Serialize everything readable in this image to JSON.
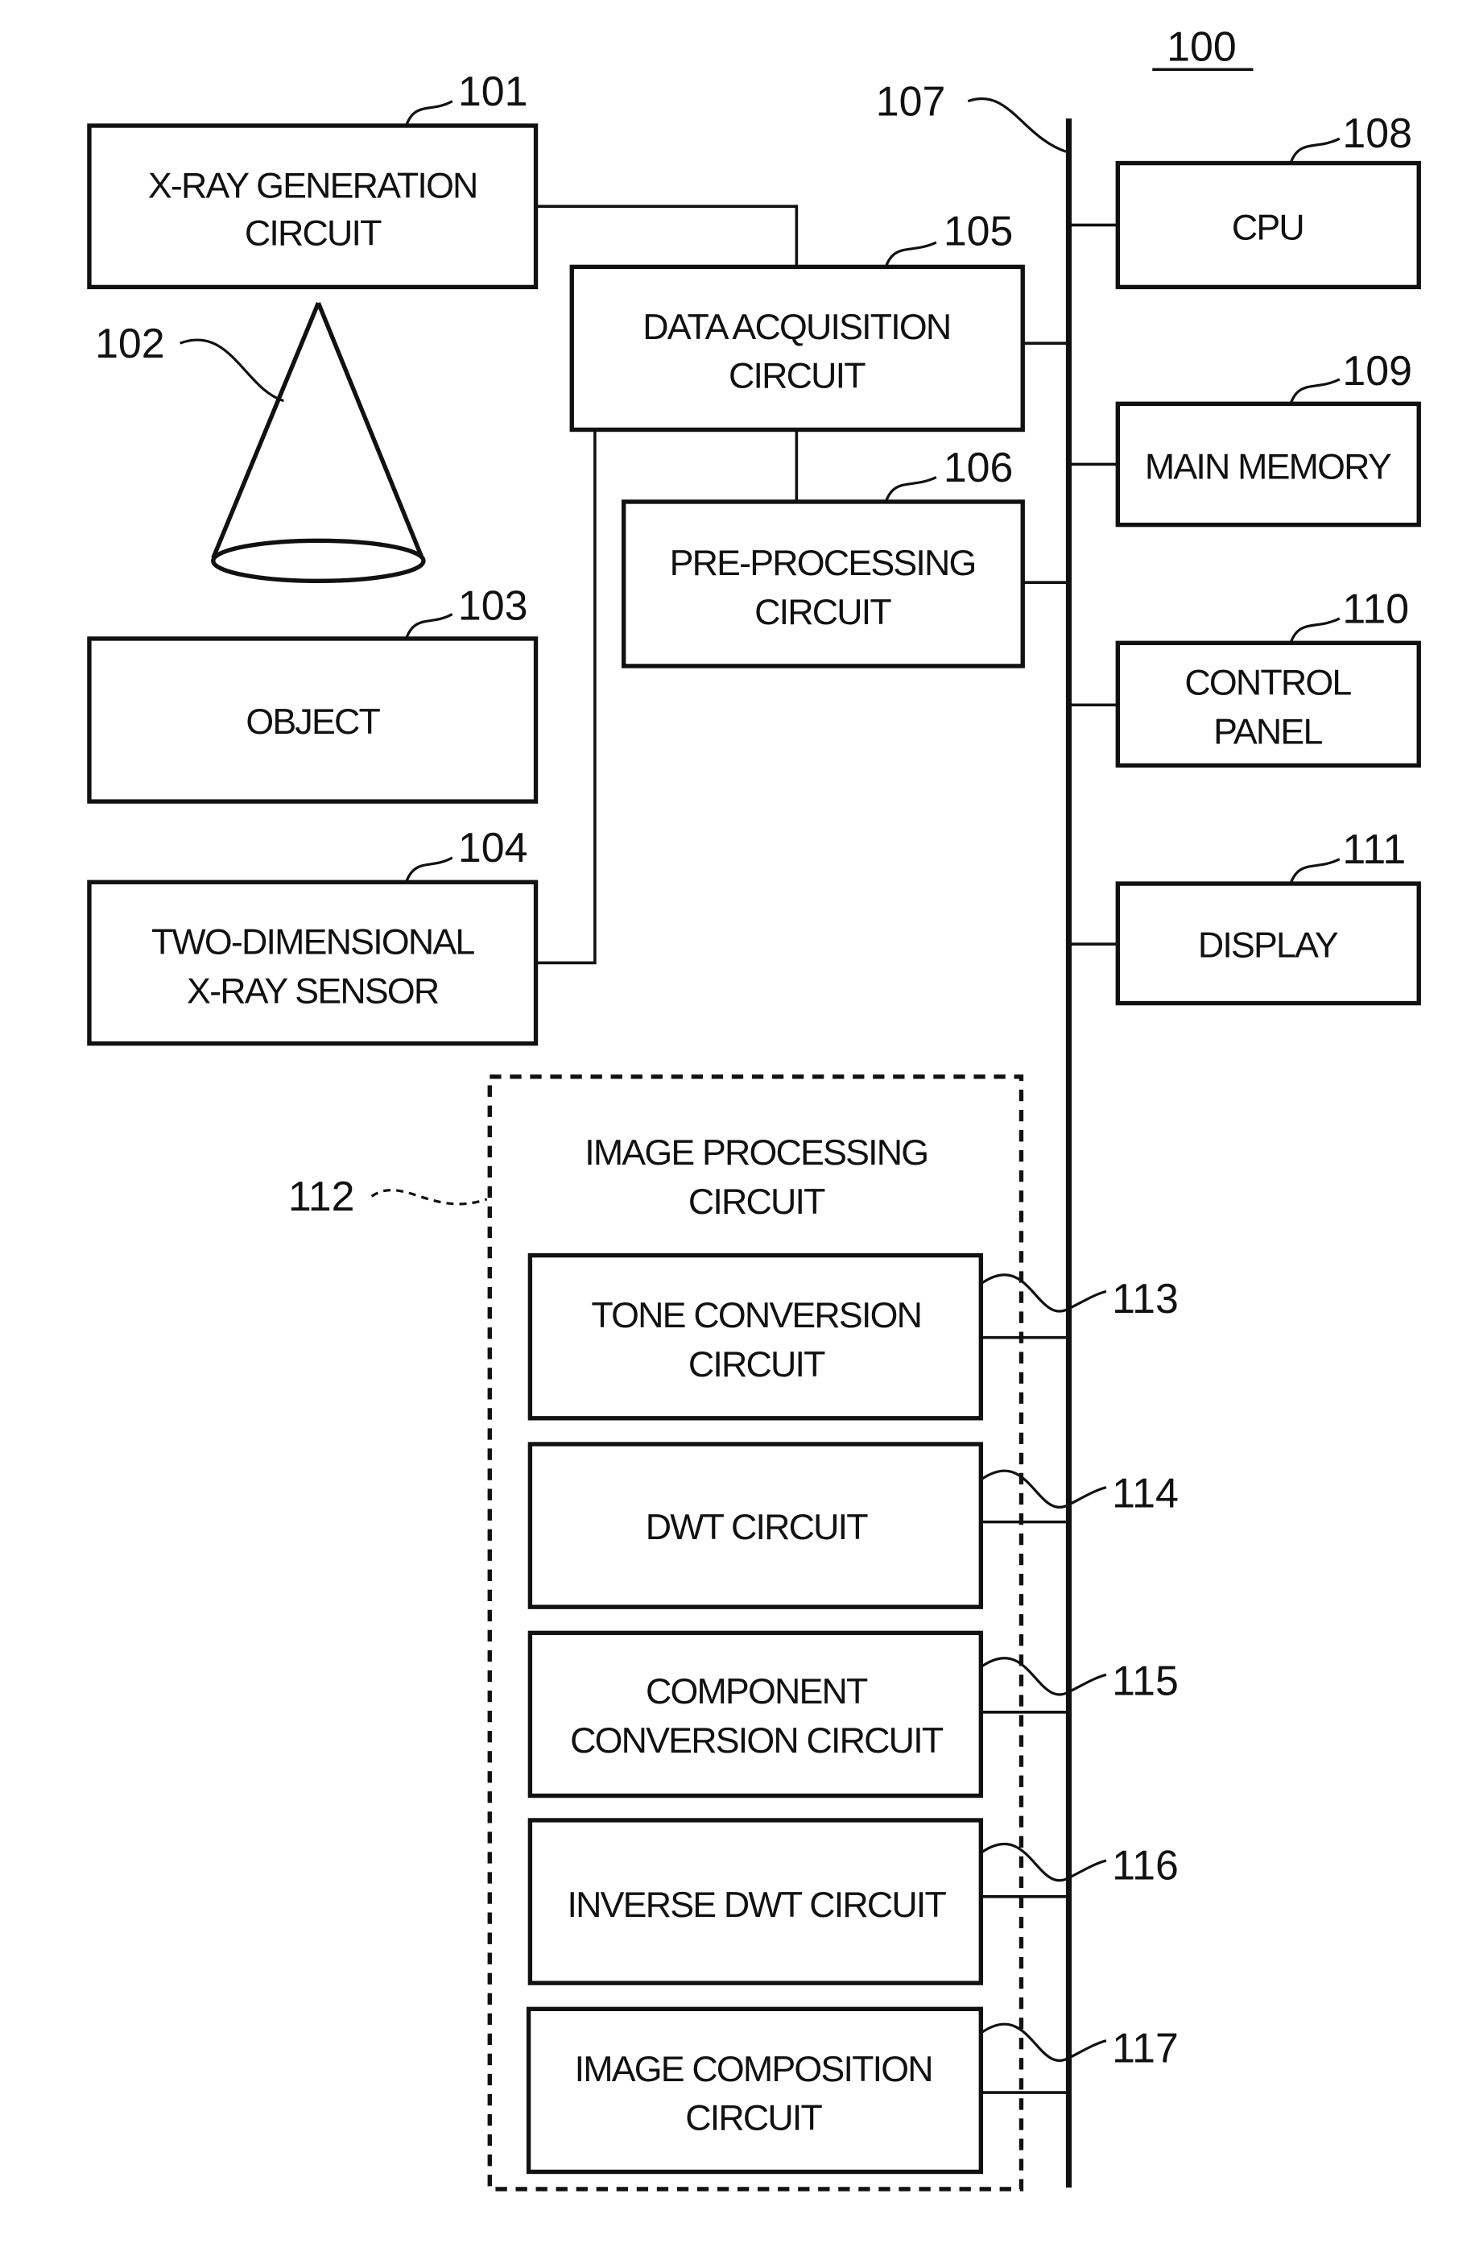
{
  "figure_ref": "100",
  "bus_ref": "107",
  "blocks": {
    "b101": {
      "ref": "101",
      "lines": [
        "X-RAY GENERATION",
        "CIRCUIT"
      ]
    },
    "b102": {
      "ref": "102",
      "lines": []
    },
    "b103": {
      "ref": "103",
      "lines": [
        "OBJECT"
      ]
    },
    "b104": {
      "ref": "104",
      "lines": [
        "TWO-DIMENSIONAL",
        "X-RAY SENSOR"
      ]
    },
    "b105": {
      "ref": "105",
      "lines": [
        "DATA ACQUISITION",
        "CIRCUIT"
      ]
    },
    "b106": {
      "ref": "106",
      "lines": [
        "PRE-PROCESSING",
        "CIRCUIT"
      ]
    },
    "b108": {
      "ref": "108",
      "lines": [
        "CPU"
      ]
    },
    "b109": {
      "ref": "109",
      "lines": [
        "MAIN MEMORY"
      ]
    },
    "b110": {
      "ref": "110",
      "lines": [
        "CONTROL",
        "PANEL"
      ]
    },
    "b111": {
      "ref": "111",
      "lines": [
        "DISPLAY"
      ]
    },
    "b112": {
      "ref": "112",
      "lines": [
        "IMAGE PROCESSING",
        "CIRCUIT"
      ]
    },
    "b113": {
      "ref": "113",
      "lines": [
        "TONE CONVERSION",
        "CIRCUIT"
      ]
    },
    "b114": {
      "ref": "114",
      "lines": [
        "DWT CIRCUIT"
      ]
    },
    "b115": {
      "ref": "115",
      "lines": [
        "COMPONENT",
        "CONVERSION CIRCUIT"
      ]
    },
    "b116": {
      "ref": "116",
      "lines": [
        "INVERSE DWT CIRCUIT"
      ]
    },
    "b117": {
      "ref": "117",
      "lines": [
        "IMAGE COMPOSITION",
        "CIRCUIT"
      ]
    }
  }
}
